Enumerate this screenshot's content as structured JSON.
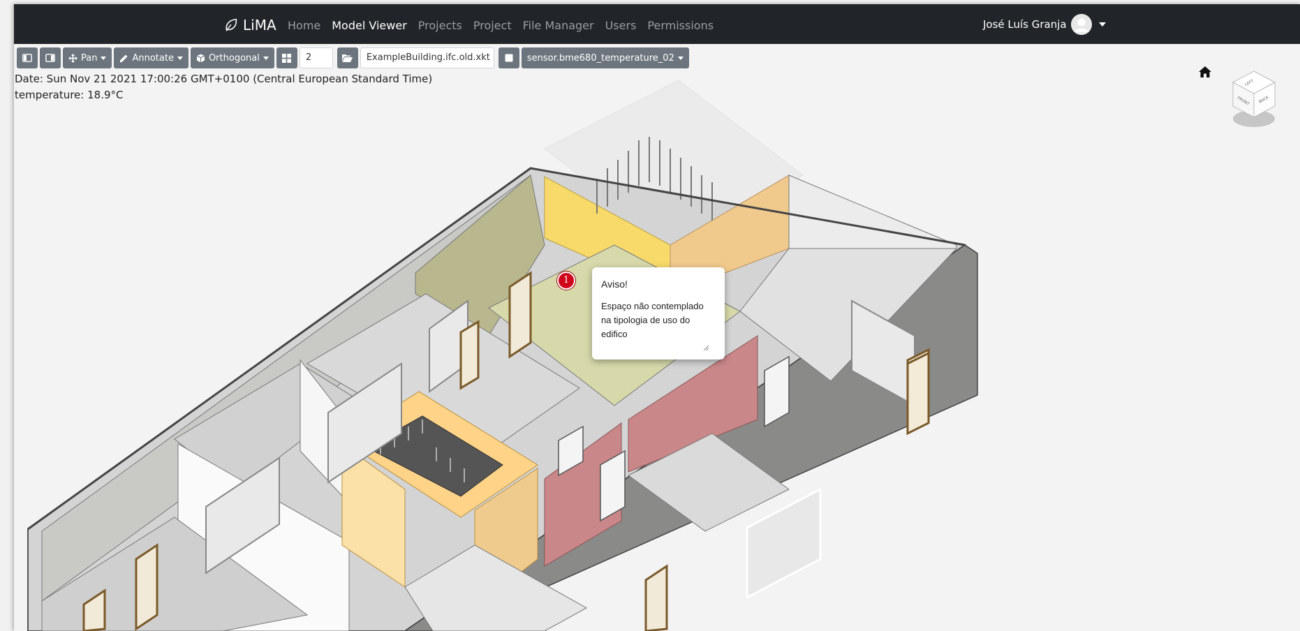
{
  "navbar": {
    "brand": "LiMA",
    "links": [
      "Home",
      "Model Viewer",
      "Projects",
      "Project",
      "File Manager",
      "Users",
      "Permissions"
    ],
    "active_link": "Model Viewer",
    "user_name": "José Luís Granja",
    "bg_color": "#212529"
  },
  "toolbar": {
    "pan_label": "Pan",
    "annotate_label": "Annotate",
    "projection_label": "Orthogonal",
    "storey_value": "2",
    "file_value": "ExampleBuilding.ifc.old.xkt",
    "sensor_label": "sensor.bme680_temperature_02",
    "button_color": "#6c757d"
  },
  "sensor_info": {
    "date_line": "Date: Sun Nov 21 2021 17:00:26 GMT+0100 (Central European Standard Time)",
    "temperature_line": "temperature: 18.9°C"
  },
  "annotation": {
    "marker_label": "1",
    "title": "Aviso!",
    "body": "Espaço não contemplado na tipologia de uso do edifico"
  },
  "navcube": {
    "faces": [
      "LEFT",
      "FRONT",
      "BACK"
    ]
  },
  "icons": {
    "home": "home-icon",
    "brand": "leaf-icon",
    "pan": "move-arrows-icon",
    "annotate": "pencil-icon",
    "projection": "cube-icon",
    "storeys": "grid-icon",
    "folder": "folder-open-icon",
    "stop": "square-icon"
  },
  "colors": {
    "highlight_yellow": "#f7da6a",
    "highlight_orange": "#f0c98c",
    "highlight_red": "#c9878a",
    "exterior_wall": "#8a8a88",
    "marker_red": "#d0021b"
  }
}
